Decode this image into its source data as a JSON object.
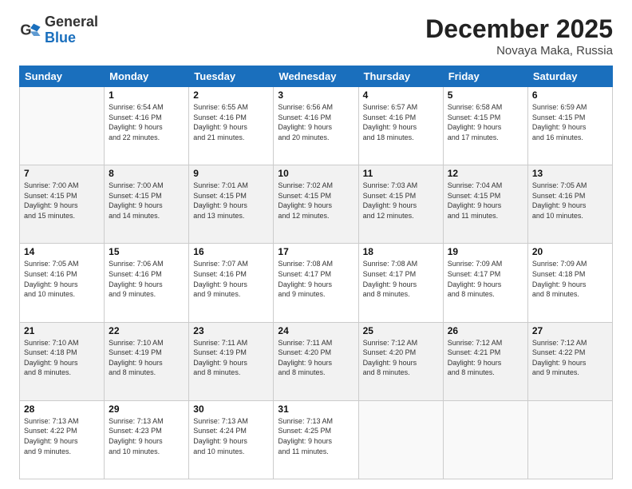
{
  "logo": {
    "general": "General",
    "blue": "Blue"
  },
  "title": "December 2025",
  "location": "Novaya Maka, Russia",
  "days_of_week": [
    "Sunday",
    "Monday",
    "Tuesday",
    "Wednesday",
    "Thursday",
    "Friday",
    "Saturday"
  ],
  "weeks": [
    [
      {
        "day": "",
        "info": ""
      },
      {
        "day": "1",
        "info": "Sunrise: 6:54 AM\nSunset: 4:16 PM\nDaylight: 9 hours\nand 22 minutes."
      },
      {
        "day": "2",
        "info": "Sunrise: 6:55 AM\nSunset: 4:16 PM\nDaylight: 9 hours\nand 21 minutes."
      },
      {
        "day": "3",
        "info": "Sunrise: 6:56 AM\nSunset: 4:16 PM\nDaylight: 9 hours\nand 20 minutes."
      },
      {
        "day": "4",
        "info": "Sunrise: 6:57 AM\nSunset: 4:16 PM\nDaylight: 9 hours\nand 18 minutes."
      },
      {
        "day": "5",
        "info": "Sunrise: 6:58 AM\nSunset: 4:15 PM\nDaylight: 9 hours\nand 17 minutes."
      },
      {
        "day": "6",
        "info": "Sunrise: 6:59 AM\nSunset: 4:15 PM\nDaylight: 9 hours\nand 16 minutes."
      }
    ],
    [
      {
        "day": "7",
        "info": "Sunrise: 7:00 AM\nSunset: 4:15 PM\nDaylight: 9 hours\nand 15 minutes."
      },
      {
        "day": "8",
        "info": "Sunrise: 7:00 AM\nSunset: 4:15 PM\nDaylight: 9 hours\nand 14 minutes."
      },
      {
        "day": "9",
        "info": "Sunrise: 7:01 AM\nSunset: 4:15 PM\nDaylight: 9 hours\nand 13 minutes."
      },
      {
        "day": "10",
        "info": "Sunrise: 7:02 AM\nSunset: 4:15 PM\nDaylight: 9 hours\nand 12 minutes."
      },
      {
        "day": "11",
        "info": "Sunrise: 7:03 AM\nSunset: 4:15 PM\nDaylight: 9 hours\nand 12 minutes."
      },
      {
        "day": "12",
        "info": "Sunrise: 7:04 AM\nSunset: 4:15 PM\nDaylight: 9 hours\nand 11 minutes."
      },
      {
        "day": "13",
        "info": "Sunrise: 7:05 AM\nSunset: 4:16 PM\nDaylight: 9 hours\nand 10 minutes."
      }
    ],
    [
      {
        "day": "14",
        "info": "Sunrise: 7:05 AM\nSunset: 4:16 PM\nDaylight: 9 hours\nand 10 minutes."
      },
      {
        "day": "15",
        "info": "Sunrise: 7:06 AM\nSunset: 4:16 PM\nDaylight: 9 hours\nand 9 minutes."
      },
      {
        "day": "16",
        "info": "Sunrise: 7:07 AM\nSunset: 4:16 PM\nDaylight: 9 hours\nand 9 minutes."
      },
      {
        "day": "17",
        "info": "Sunrise: 7:08 AM\nSunset: 4:17 PM\nDaylight: 9 hours\nand 9 minutes."
      },
      {
        "day": "18",
        "info": "Sunrise: 7:08 AM\nSunset: 4:17 PM\nDaylight: 9 hours\nand 8 minutes."
      },
      {
        "day": "19",
        "info": "Sunrise: 7:09 AM\nSunset: 4:17 PM\nDaylight: 9 hours\nand 8 minutes."
      },
      {
        "day": "20",
        "info": "Sunrise: 7:09 AM\nSunset: 4:18 PM\nDaylight: 9 hours\nand 8 minutes."
      }
    ],
    [
      {
        "day": "21",
        "info": "Sunrise: 7:10 AM\nSunset: 4:18 PM\nDaylight: 9 hours\nand 8 minutes."
      },
      {
        "day": "22",
        "info": "Sunrise: 7:10 AM\nSunset: 4:19 PM\nDaylight: 9 hours\nand 8 minutes."
      },
      {
        "day": "23",
        "info": "Sunrise: 7:11 AM\nSunset: 4:19 PM\nDaylight: 9 hours\nand 8 minutes."
      },
      {
        "day": "24",
        "info": "Sunrise: 7:11 AM\nSunset: 4:20 PM\nDaylight: 9 hours\nand 8 minutes."
      },
      {
        "day": "25",
        "info": "Sunrise: 7:12 AM\nSunset: 4:20 PM\nDaylight: 9 hours\nand 8 minutes."
      },
      {
        "day": "26",
        "info": "Sunrise: 7:12 AM\nSunset: 4:21 PM\nDaylight: 9 hours\nand 8 minutes."
      },
      {
        "day": "27",
        "info": "Sunrise: 7:12 AM\nSunset: 4:22 PM\nDaylight: 9 hours\nand 9 minutes."
      }
    ],
    [
      {
        "day": "28",
        "info": "Sunrise: 7:13 AM\nSunset: 4:22 PM\nDaylight: 9 hours\nand 9 minutes."
      },
      {
        "day": "29",
        "info": "Sunrise: 7:13 AM\nSunset: 4:23 PM\nDaylight: 9 hours\nand 10 minutes."
      },
      {
        "day": "30",
        "info": "Sunrise: 7:13 AM\nSunset: 4:24 PM\nDaylight: 9 hours\nand 10 minutes."
      },
      {
        "day": "31",
        "info": "Sunrise: 7:13 AM\nSunset: 4:25 PM\nDaylight: 9 hours\nand 11 minutes."
      },
      {
        "day": "",
        "info": ""
      },
      {
        "day": "",
        "info": ""
      },
      {
        "day": "",
        "info": ""
      }
    ]
  ]
}
